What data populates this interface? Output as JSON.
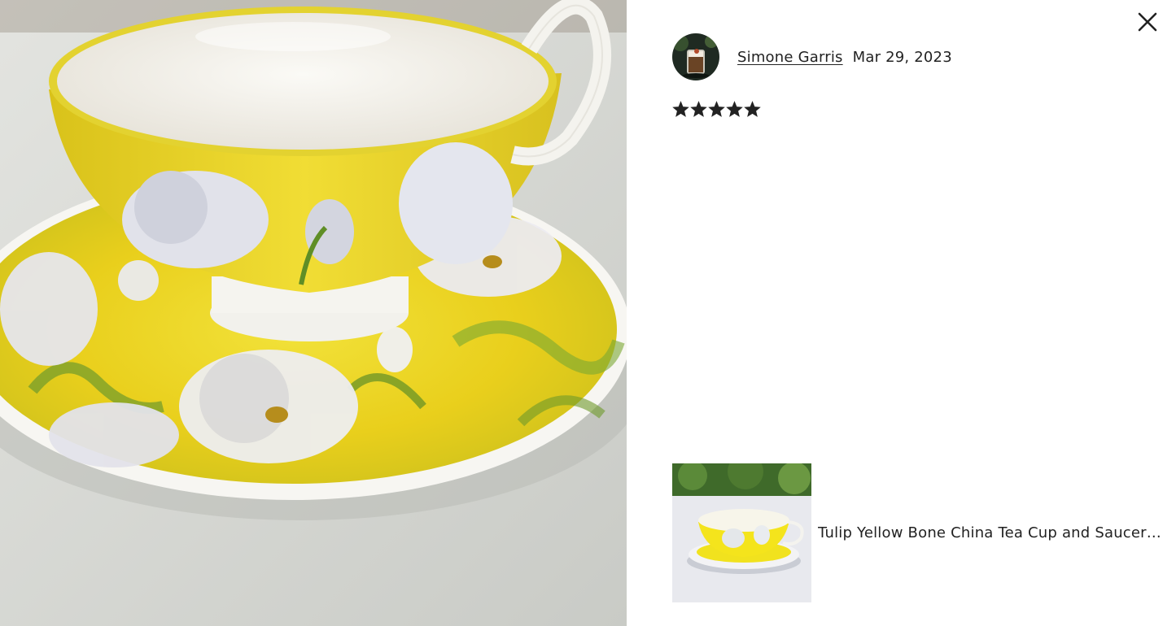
{
  "review": {
    "reviewer_name": "Simone Garris",
    "date": "Mar 29, 2023",
    "rating": 5,
    "rating_max": 5
  },
  "listing": {
    "title": "Tulip Yellow Bone China Tea Cup and Saucer Set, Gift Boxed"
  },
  "icons": {
    "close": "close-icon",
    "star": "star-icon"
  },
  "colors": {
    "text": "#222222",
    "background": "#ffffff",
    "star": "#222222"
  }
}
